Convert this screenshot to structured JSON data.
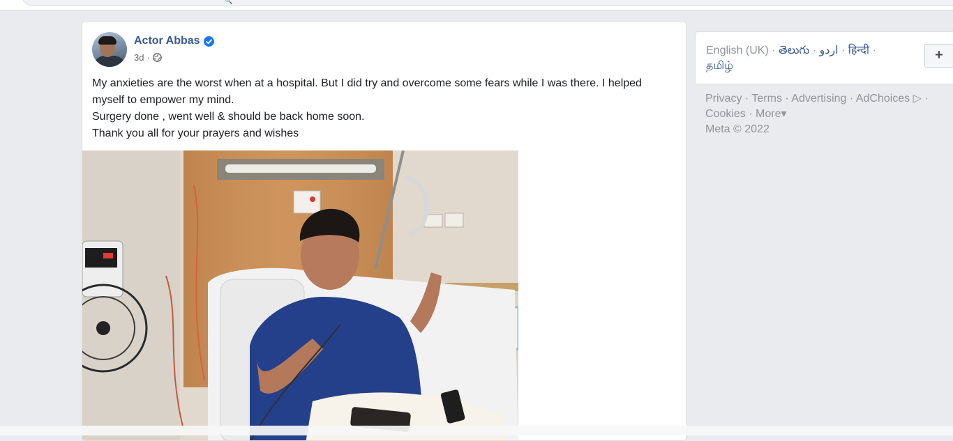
{
  "post": {
    "author": "Actor Abbas",
    "verified": true,
    "time": "3d",
    "audience_icon": "globe-icon",
    "text_lines": [
      "My anxieties are the worst when at a hospital. But I did try and overcome some fears while I was there. I helped myself to empower my mind.",
      "Surgery done , went well & should be back home soon.",
      "Thank you all for your prayers and wishes"
    ]
  },
  "languages": {
    "current": "English (UK)",
    "options": [
      "తెలుగు",
      "اردو",
      "हिन्दी",
      "தமிழ்"
    ],
    "add_label": "+"
  },
  "footer": {
    "links": [
      "Privacy",
      "Terms",
      "Advertising",
      "AdChoices",
      "Cookies",
      "More"
    ],
    "adchoices_icon": "adchoices-icon",
    "more_caret": "▾",
    "copyright": "Meta © 2022"
  },
  "colors": {
    "link": "#385898",
    "background": "#e9ebee",
    "verified": "#1877f2"
  }
}
